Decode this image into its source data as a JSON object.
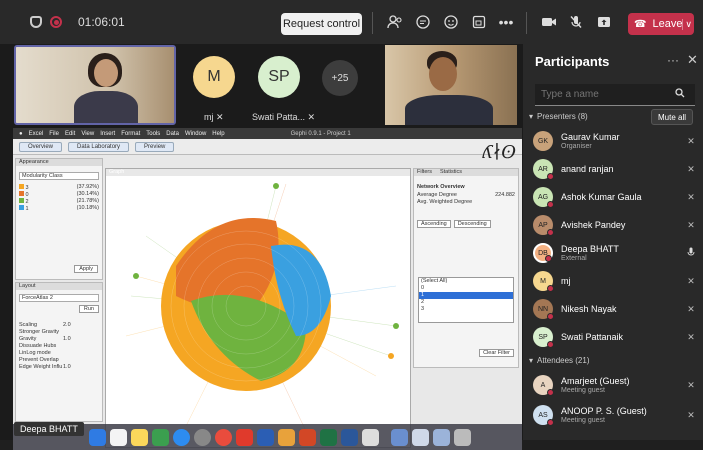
{
  "topbar": {
    "timer": "01:06:01",
    "request_control": "Request control",
    "leave": "Leave"
  },
  "stage": {
    "tiles": [
      {
        "initials": "M",
        "name": "mj",
        "color": "#f6d78f"
      },
      {
        "initials": "SP",
        "name": "Swati Patta...",
        "color": "#d8efce"
      },
      {
        "initials": "+25",
        "name": "",
        "color": "#3d3d3d"
      }
    ],
    "presenter_tag": "Deepa BHATT",
    "shared": {
      "mac_menu": [
        "Excel",
        "File",
        "Edit",
        "View",
        "Insert",
        "Format",
        "Tools",
        "Data",
        "Window",
        "Help"
      ],
      "gephi_tabs": [
        "Overview",
        "Data Laboratory",
        "Preview"
      ],
      "window_title": "Gephi 0.9.1 - Project 1",
      "appearance_title": "Appearance",
      "modularity_class": "Modularity Class",
      "legend": [
        {
          "label": "3",
          "pct": "(37.92%)",
          "color": "#f5a623"
        },
        {
          "label": "0",
          "pct": "(30.14%)",
          "color": "#e5742a"
        },
        {
          "label": "2",
          "pct": "(21.78%)",
          "color": "#6fb33f"
        },
        {
          "label": "1",
          "pct": "(10.18%)",
          "color": "#3aa0e0"
        }
      ],
      "apply": "Apply",
      "layout_title": "Layout",
      "layout_name": "ForceAtlas 2",
      "layout_params": [
        {
          "name": "Scaling",
          "value": "2.0"
        },
        {
          "name": "Stronger Gravity",
          "value": ""
        },
        {
          "name": "Gravity",
          "value": "1.0"
        },
        {
          "name": "Dissuade Hubs",
          "value": ""
        },
        {
          "name": "LinLog mode",
          "value": ""
        },
        {
          "name": "Prevent Overlap",
          "value": ""
        },
        {
          "name": "Edge Weight Influ",
          "value": "1.0"
        }
      ],
      "run": "Run",
      "graph_title": "Graph",
      "filters_title": "Filters",
      "statistics_title": "Statistics",
      "network_overview": "Network Overview",
      "stats": [
        {
          "name": "Average Degree",
          "value": "224.882"
        },
        {
          "name": "Avg. Weighted Degree",
          "value": ""
        }
      ],
      "sort_ascending": "Ascending",
      "sort_descending": "Descending",
      "select_all": "(Select All)",
      "options": [
        "0",
        "1",
        "2",
        "3"
      ],
      "clear_filter": "Clear Filter"
    }
  },
  "participants": {
    "title": "Participants",
    "search_placeholder": "Type a name",
    "presenters_header": "Presenters (8)",
    "mute_all": "Mute all",
    "attendees_header": "Attendees (21)",
    "presenters": [
      {
        "initials": "GK",
        "name": "Gaurav Kumar",
        "sub": "Organiser",
        "color": "#c8a27a"
      },
      {
        "initials": "AR",
        "name": "anand ranjan",
        "sub": "",
        "color": "#c9e5b4"
      },
      {
        "initials": "AG",
        "name": "Ashok Kumar Gaula",
        "sub": "",
        "color": "#c9e5b4"
      },
      {
        "initials": "AP",
        "name": "Avishek Pandey",
        "sub": "",
        "color": "#b98c6b"
      },
      {
        "initials": "DB",
        "name": "Deepa BHATT",
        "sub": "External",
        "color": "#f4b183"
      },
      {
        "initials": "M",
        "name": "mj",
        "sub": "",
        "color": "#f6d78f"
      },
      {
        "initials": "NN",
        "name": "Nikesh Nayak",
        "sub": "",
        "color": "#a47754"
      },
      {
        "initials": "SP",
        "name": "Swati Pattanaik",
        "sub": "",
        "color": "#d8efce"
      }
    ],
    "attendees": [
      {
        "initials": "A",
        "name": "Amarjeet (Guest)",
        "sub": "Meeting guest",
        "color": "#e8d4c0"
      },
      {
        "initials": "AS",
        "name": "ANOOP P. S. (Guest)",
        "sub": "Meeting guest",
        "color": "#cfe0f0"
      }
    ]
  }
}
